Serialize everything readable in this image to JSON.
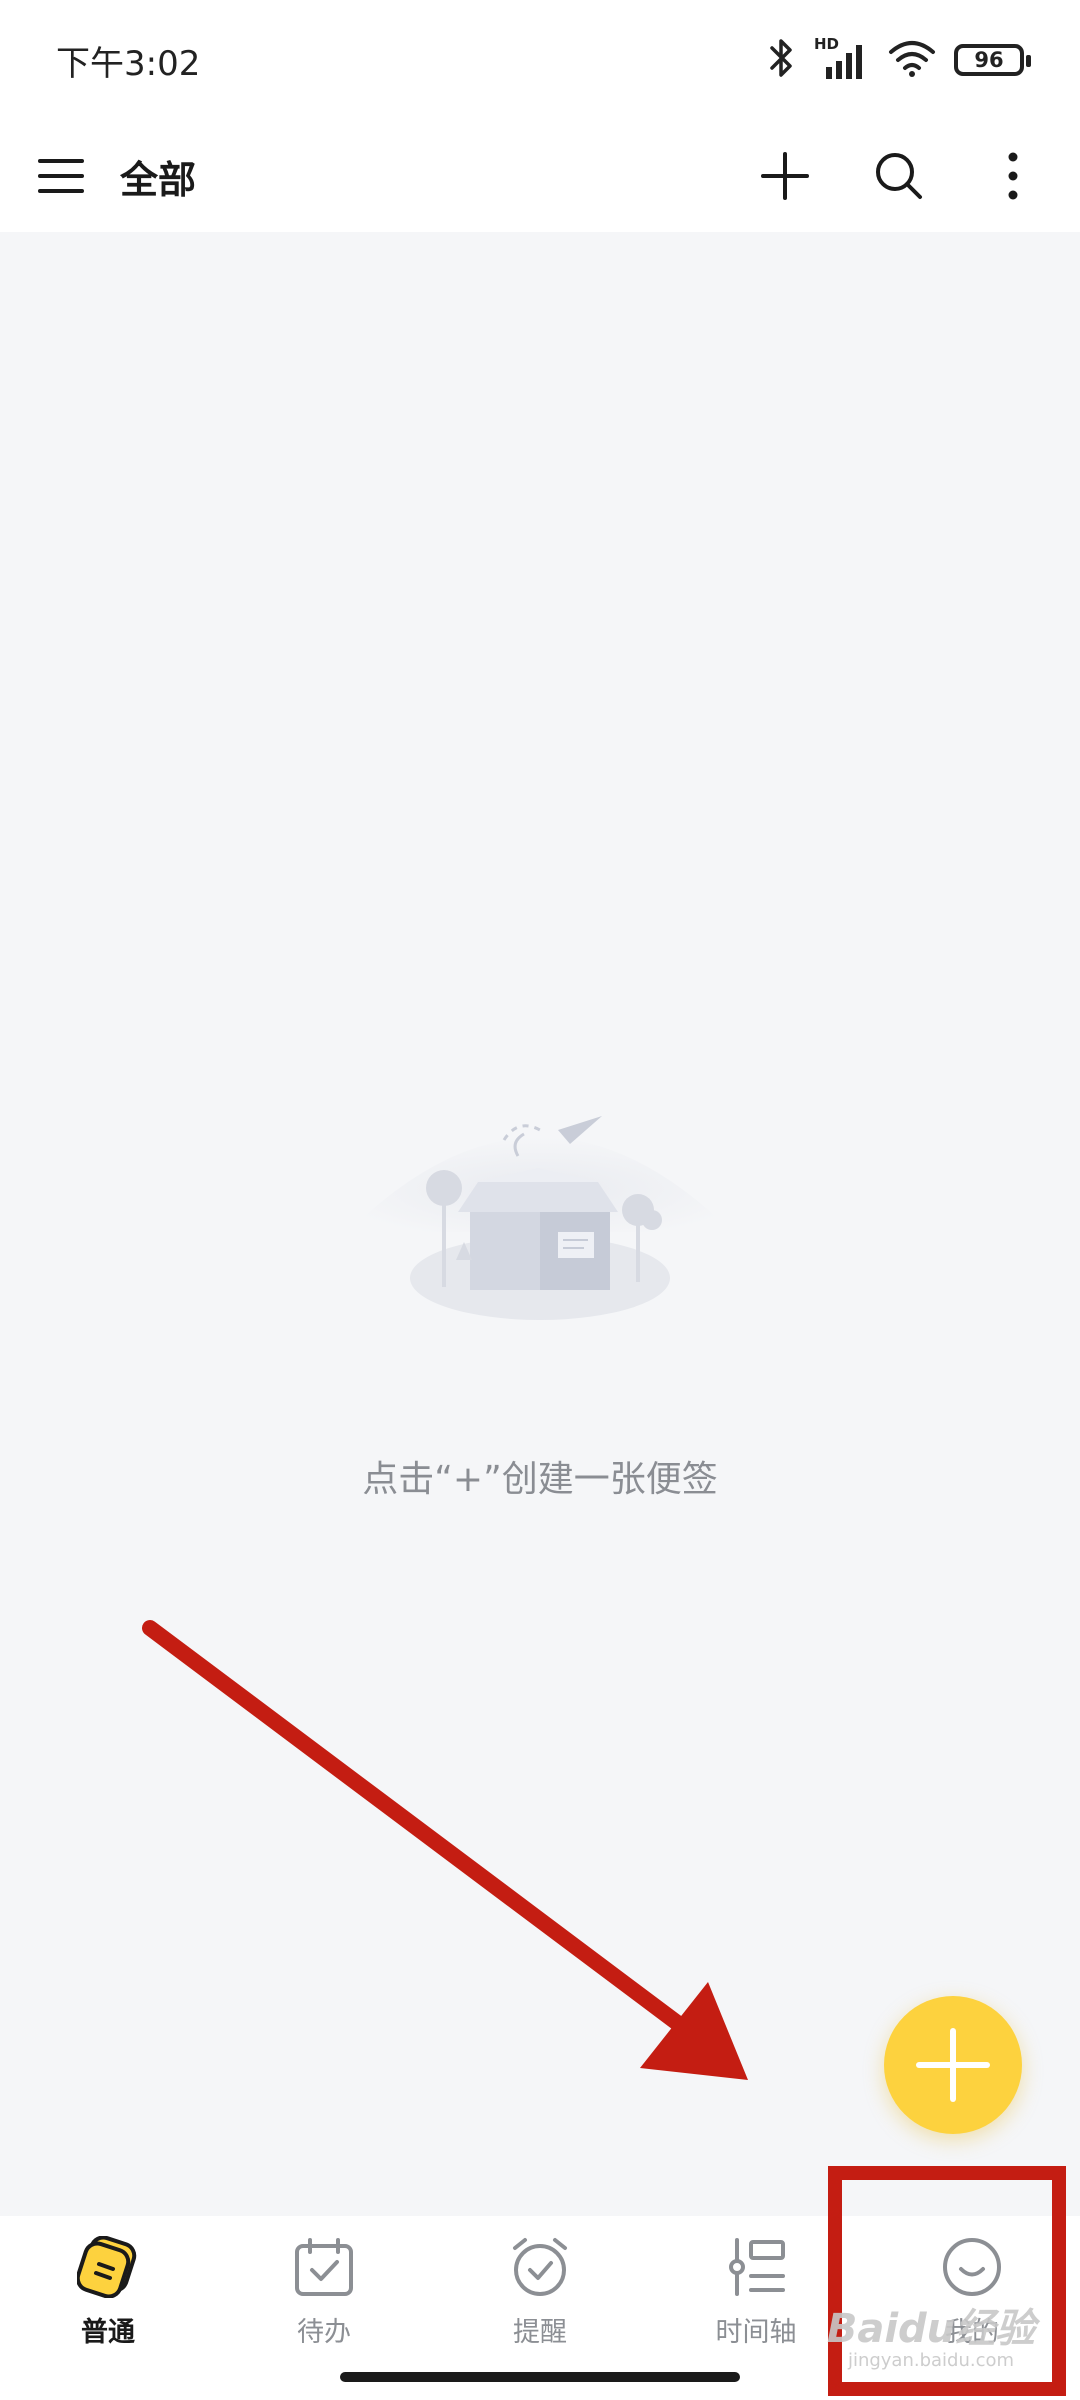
{
  "status_bar": {
    "time": "下午3:02",
    "battery": "96",
    "network_label": "HD",
    "icons": [
      "bluetooth-icon",
      "signal-icon",
      "wifi-icon",
      "battery-icon"
    ]
  },
  "app_bar": {
    "title": "全部",
    "icons": [
      "menu-icon",
      "plus-icon",
      "search-icon",
      "more-vertical-icon"
    ]
  },
  "empty_state": {
    "message": "点击“+”创建一张便签",
    "icon": "empty-box-illustration"
  },
  "fab": {
    "icon": "plus-icon",
    "color": "#fdd23e"
  },
  "bottom_nav": {
    "items": [
      {
        "label": "普通",
        "icon": "note-icon",
        "active": true
      },
      {
        "label": "待办",
        "icon": "calendar-check-icon",
        "active": false
      },
      {
        "label": "提醒",
        "icon": "alarm-clock-icon",
        "active": false
      },
      {
        "label": "时间轴",
        "icon": "timeline-icon",
        "active": false
      },
      {
        "label": "我的",
        "icon": "smiley-icon",
        "active": false
      }
    ]
  },
  "annotation": {
    "arrow_color": "#c41d12",
    "highlight_color": "#c41d12",
    "watermark": "Baidu经验",
    "watermark_sub": "jingyan.baidu.com"
  },
  "colors": {
    "background": "#f5f6f8",
    "accent": "#fdd23e",
    "active_text": "#1a1a1a",
    "inactive_text": "#8c8f94"
  }
}
